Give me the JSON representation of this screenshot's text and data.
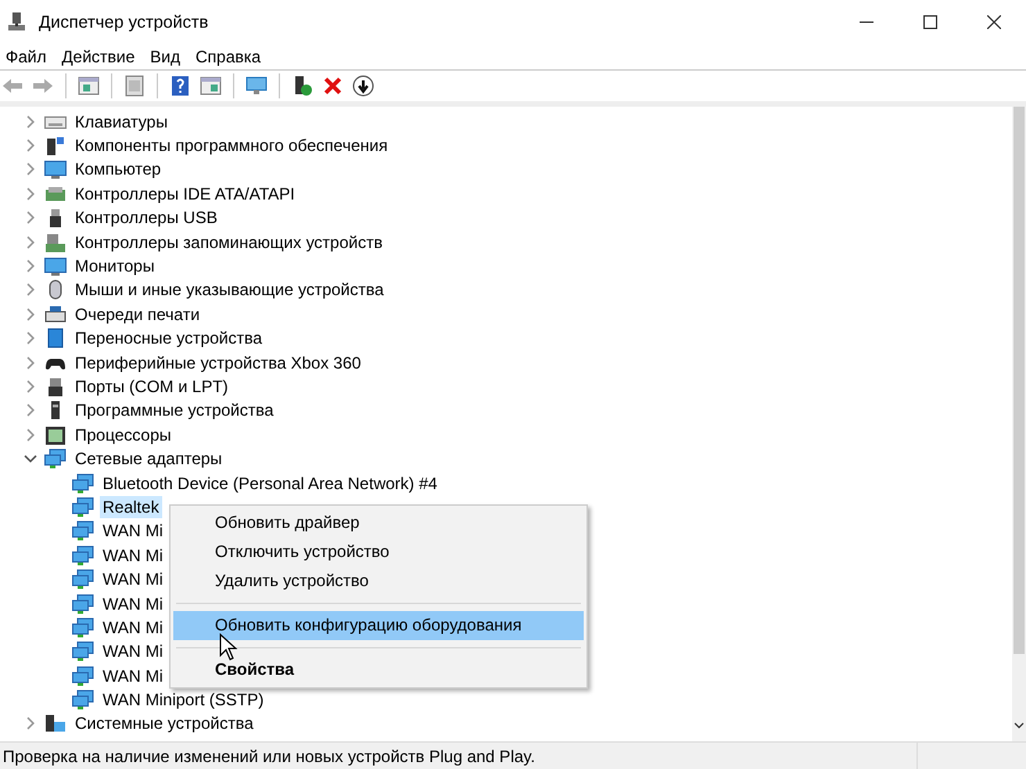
{
  "window": {
    "title": "Диспетчер устройств"
  },
  "menu": [
    {
      "label": "Файл"
    },
    {
      "label": "Действие"
    },
    {
      "label": "Вид"
    },
    {
      "label": "Справка"
    }
  ],
  "tree": [
    {
      "label": "Клавиатуры",
      "expanded": false,
      "selected": false
    },
    {
      "label": "Компоненты программного обеспечения",
      "expanded": false,
      "selected": false
    },
    {
      "label": "Компьютер",
      "expanded": false,
      "selected": false
    },
    {
      "label": "Контроллеры IDE ATA/ATAPI",
      "expanded": false,
      "selected": false
    },
    {
      "label": "Контроллеры USB",
      "expanded": false,
      "selected": false
    },
    {
      "label": "Контроллеры запоминающих устройств",
      "expanded": false,
      "selected": false
    },
    {
      "label": "Мониторы",
      "expanded": false,
      "selected": false
    },
    {
      "label": "Мыши и иные указывающие устройства",
      "expanded": false,
      "selected": false
    },
    {
      "label": "Очереди печати",
      "expanded": false,
      "selected": false
    },
    {
      "label": "Переносные устройства",
      "expanded": false,
      "selected": false
    },
    {
      "label": "Периферийные устройства Xbox 360",
      "expanded": false,
      "selected": false
    },
    {
      "label": "Порты (COM и LPT)",
      "expanded": false,
      "selected": false
    },
    {
      "label": "Программные устройства",
      "expanded": false,
      "selected": false
    },
    {
      "label": "Процессоры",
      "expanded": false,
      "selected": false
    },
    {
      "label": "Сетевые адаптеры",
      "expanded": true,
      "selected": false,
      "children": [
        {
          "label": "Bluetooth Device (Personal Area Network) #4",
          "selected": false
        },
        {
          "label": "Realtek",
          "selected": true
        },
        {
          "label": "WAN Mi",
          "selected": false
        },
        {
          "label": "WAN Mi",
          "selected": false
        },
        {
          "label": "WAN Mi",
          "selected": false
        },
        {
          "label": "WAN Mi",
          "selected": false
        },
        {
          "label": "WAN Mi",
          "selected": false
        },
        {
          "label": "WAN Mi",
          "selected": false
        },
        {
          "label": "WAN Mi",
          "selected": false
        },
        {
          "label": "WAN Miniport (SSTP)",
          "selected": false
        }
      ]
    },
    {
      "label": "Системные устройства",
      "expanded": false,
      "selected": false
    }
  ],
  "context_menu": [
    {
      "kind": "item",
      "label": "Обновить драйвер",
      "selected": false,
      "default": false
    },
    {
      "kind": "item",
      "label": "Отключить устройство",
      "selected": false,
      "default": false
    },
    {
      "kind": "item",
      "label": "Удалить устройство",
      "selected": false,
      "default": false
    },
    {
      "kind": "separator"
    },
    {
      "kind": "item",
      "label": "Обновить конфигурацию оборудования",
      "selected": true,
      "default": false
    },
    {
      "kind": "separator"
    },
    {
      "kind": "item",
      "label": "Свойства",
      "selected": false,
      "default": true
    }
  ],
  "status_bar": {
    "text": "Проверка на наличие изменений или новых устройств Plug and Play."
  }
}
